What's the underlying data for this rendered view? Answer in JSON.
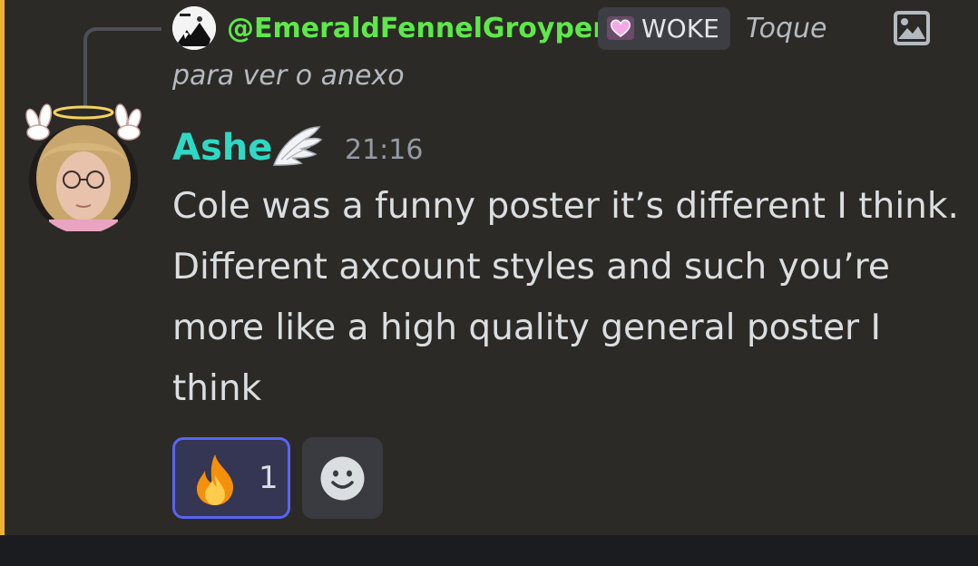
{
  "reply": {
    "author": "@EmeraldFennelGroyper",
    "role_tag": "WOKE",
    "preview_line1": "Toque",
    "preview_line2": "para ver o anexo",
    "attachment_icon": "image-icon",
    "author_color": "#5ee84a"
  },
  "message": {
    "author": "Ashe",
    "author_badge_icon": "angel-wing-icon",
    "timestamp": "21:16",
    "body": "Cole was a funny poster it’s different I think. Different axcount styles and such you’re more like a high quality general poster I think",
    "author_color": "#2fd8c4"
  },
  "reactions": [
    {
      "emoji_icon": "fire-icon",
      "count": "1",
      "reacted": true
    }
  ],
  "add_reaction_icon": "smiley-add-icon",
  "colors": {
    "background": "#2c2a26",
    "mention_bar": "#f0b132",
    "reaction_border": "#5865f2"
  }
}
